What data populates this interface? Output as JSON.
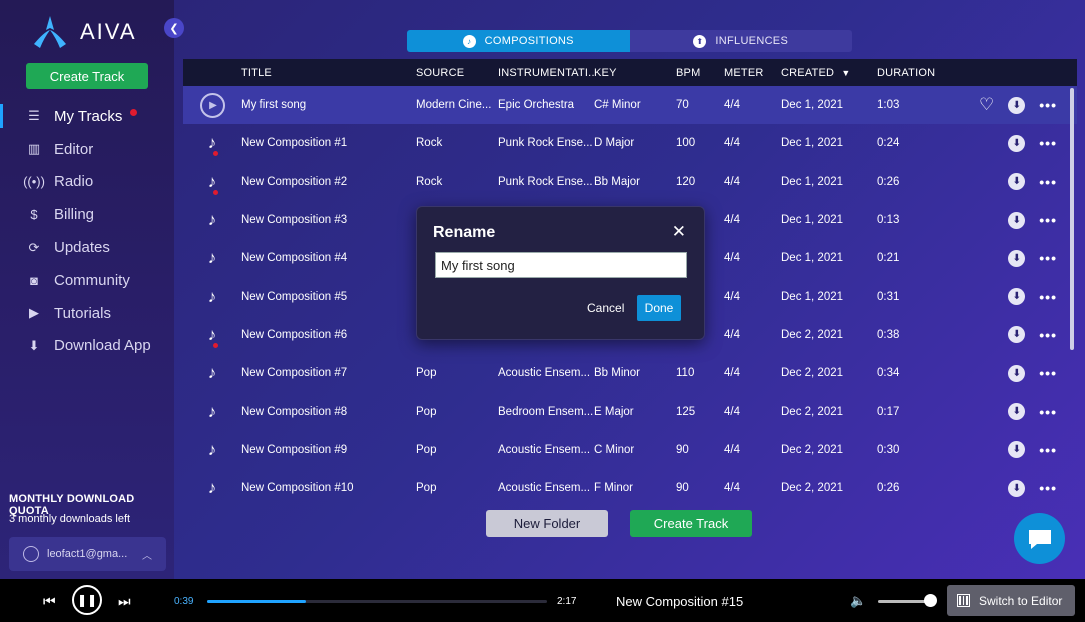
{
  "app": {
    "name": "AIVA"
  },
  "sidebar": {
    "create_track": "Create Track",
    "items": [
      {
        "label": "My Tracks",
        "icon": "list-icon",
        "active": true,
        "badge": true
      },
      {
        "label": "Editor",
        "icon": "piano-icon"
      },
      {
        "label": "Radio",
        "icon": "radio-icon"
      },
      {
        "label": "Billing",
        "icon": "dollar-icon"
      },
      {
        "label": "Updates",
        "icon": "refresh-icon"
      },
      {
        "label": "Community",
        "icon": "discord-icon"
      },
      {
        "label": "Tutorials",
        "icon": "youtube-icon"
      },
      {
        "label": "Download App",
        "icon": "download-icon"
      }
    ],
    "quota_title": "MONTHLY DOWNLOAD QUOTA",
    "quota_text": "3 monthly downloads left",
    "account": "leofact1@gma..."
  },
  "tabs": [
    {
      "label": "COMPOSITIONS",
      "active": true
    },
    {
      "label": "INFLUENCES",
      "active": false
    }
  ],
  "table": {
    "headers": {
      "title": "TITLE",
      "source": "SOURCE",
      "instrumentation": "INSTRUMENTATI...",
      "key": "KEY",
      "bpm": "BPM",
      "meter": "METER",
      "created": "CREATED",
      "duration": "DURATION"
    },
    "rows": [
      {
        "title": "My first song",
        "source": "Modern Cine...",
        "inst": "Epic Orchestra",
        "key": "C# Minor",
        "bpm": "70",
        "meter": "4/4",
        "created": "Dec 1, 2021",
        "duration": "1:03",
        "playing": true
      },
      {
        "title": "New Composition #1",
        "source": "Rock",
        "inst": "Punk Rock Ense...",
        "key": "D Major",
        "bpm": "100",
        "meter": "4/4",
        "created": "Dec 1, 2021",
        "duration": "0:24",
        "unread": true
      },
      {
        "title": "New Composition #2",
        "source": "Rock",
        "inst": "Punk Rock Ense...",
        "key": "Bb Major",
        "bpm": "120",
        "meter": "4/4",
        "created": "Dec 1, 2021",
        "duration": "0:26",
        "unread": true
      },
      {
        "title": "New Composition #3",
        "source": "",
        "inst": "",
        "key": "",
        "bpm": "",
        "meter": "4/4",
        "created": "Dec 1, 2021",
        "duration": "0:13"
      },
      {
        "title": "New Composition #4",
        "source": "",
        "inst": "",
        "key": "",
        "bpm": "",
        "meter": "4/4",
        "created": "Dec 1, 2021",
        "duration": "0:21"
      },
      {
        "title": "New Composition #5",
        "source": "",
        "inst": "",
        "key": "",
        "bpm": "",
        "meter": "4/4",
        "created": "Dec 1, 2021",
        "duration": "0:31"
      },
      {
        "title": "New Composition #6",
        "source": "",
        "inst": "",
        "key": "",
        "bpm": "",
        "meter": "4/4",
        "created": "Dec 2, 2021",
        "duration": "0:38",
        "unread": true
      },
      {
        "title": "New Composition #7",
        "source": "Pop",
        "inst": "Acoustic Ensem...",
        "key": "Bb Minor",
        "bpm": "110",
        "meter": "4/4",
        "created": "Dec 2, 2021",
        "duration": "0:34"
      },
      {
        "title": "New Composition #8",
        "source": "Pop",
        "inst": "Bedroom Ensem...",
        "key": "E Major",
        "bpm": "125",
        "meter": "4/4",
        "created": "Dec 2, 2021",
        "duration": "0:17"
      },
      {
        "title": "New Composition #9",
        "source": "Pop",
        "inst": "Acoustic Ensem...",
        "key": "C Minor",
        "bpm": "90",
        "meter": "4/4",
        "created": "Dec 2, 2021",
        "duration": "0:30"
      },
      {
        "title": "New Composition #10",
        "source": "Pop",
        "inst": "Acoustic Ensem...",
        "key": "F Minor",
        "bpm": "90",
        "meter": "4/4",
        "created": "Dec 2, 2021",
        "duration": "0:26"
      }
    ]
  },
  "buttons": {
    "new_folder": "New Folder",
    "create_track": "Create Track"
  },
  "dialog": {
    "title": "Rename",
    "value": "My first song",
    "cancel": "Cancel",
    "done": "Done"
  },
  "player": {
    "current": "0:39",
    "duration": "2:17",
    "progress": 0.29,
    "song": "New Composition #15",
    "volume": 0.85,
    "switch": "Switch to Editor"
  },
  "colors": {
    "accent": "#0e90d8",
    "green": "#1fa855",
    "badge": "#e01b2f"
  }
}
